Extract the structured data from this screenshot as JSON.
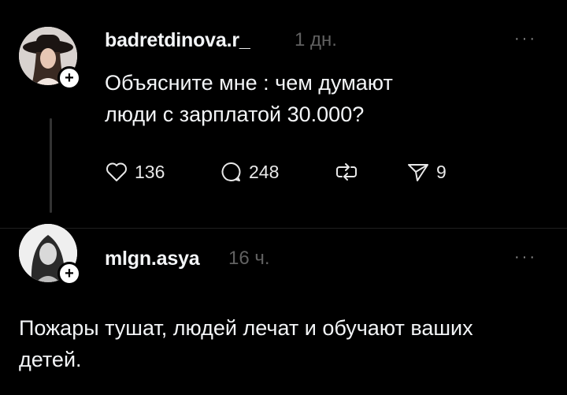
{
  "posts": [
    {
      "username": "badretdinova.r_",
      "time": "1 дн.",
      "more": "···",
      "text": "Объясните мне : чем думают люди с зарплатой 30.000?",
      "actions": {
        "likes": "136",
        "comments": "248",
        "shares": "9"
      }
    },
    {
      "username": "mlgn.asya",
      "time": "16 ч.",
      "more": "···",
      "text": "Пожары тушат, людей лечат и обучают ваших детей."
    }
  ],
  "icons": {
    "like": "heart-icon",
    "comment": "comment-bubble-icon",
    "repost": "repost-icon",
    "share": "send-icon",
    "follow": "plus-icon"
  },
  "colors": {
    "background": "#000000",
    "text": "#f3f5f7",
    "muted": "#616161"
  }
}
